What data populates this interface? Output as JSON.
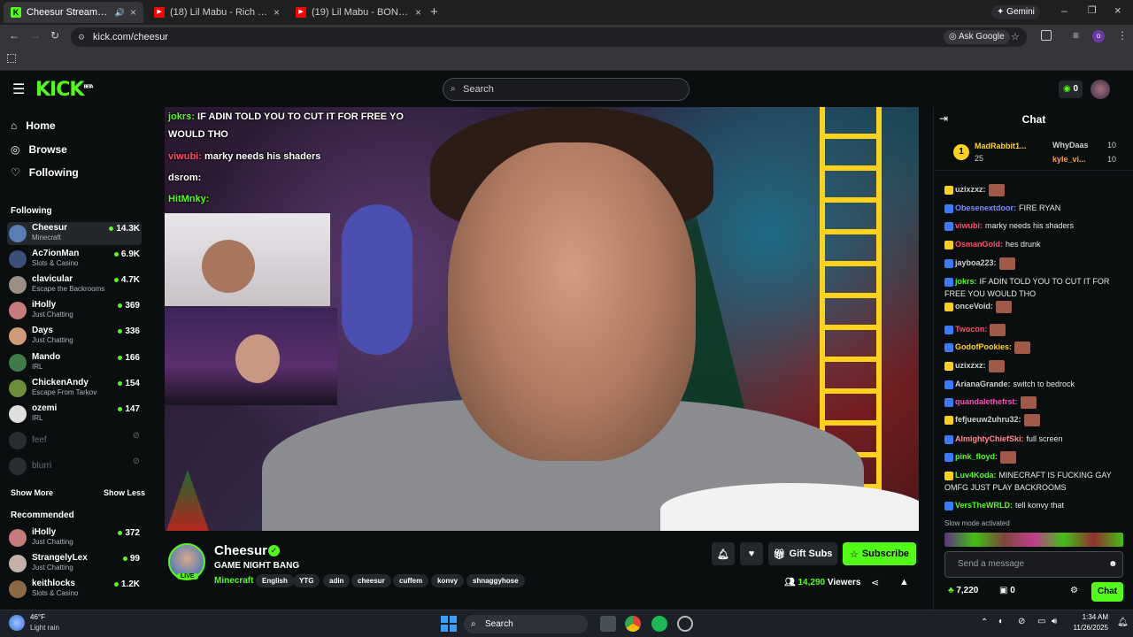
{
  "browser": {
    "tabs": [
      {
        "title": "Cheesur Stream - Watch Live",
        "favicon": "kick",
        "active": true
      },
      {
        "title": "(18) Lil Mabu - Rich Scholar (In…",
        "favicon": "youtube",
        "active": false
      },
      {
        "title": "(19) Lil Mabu - BONNIE BLU (Li…",
        "favicon": "youtube",
        "active": false
      }
    ],
    "gemini_label": "Gemini",
    "url": "kick.com/cheesur",
    "ask_google": "Ask Google"
  },
  "kick": {
    "logo": "KICK",
    "beta": "BETA",
    "search_placeholder": "Search",
    "kicks_count": "0"
  },
  "sidebar": {
    "nav": [
      {
        "label": "Home",
        "icon": "home-icon"
      },
      {
        "label": "Browse",
        "icon": "compass-icon"
      },
      {
        "label": "Following",
        "icon": "heart-icon"
      }
    ],
    "following_title": "Following",
    "following": [
      {
        "name": "Cheesur",
        "game": "Minecraft",
        "viewers": "14.3K",
        "color": "#5b7fb5"
      },
      {
        "name": "Ac7ionMan",
        "game": "Slots & Casino",
        "viewers": "6.9K",
        "color": "#3a4f7a"
      },
      {
        "name": "clavicular",
        "game": "Escape the Backrooms",
        "viewers": "4.7K",
        "color": "#9c8f86"
      },
      {
        "name": "iHolly",
        "game": "Just Chatting",
        "viewers": "369",
        "color": "#c67c7c"
      },
      {
        "name": "Days",
        "game": "Just Chatting",
        "viewers": "336",
        "color": "#d09a7a"
      },
      {
        "name": "Mando",
        "game": "IRL",
        "viewers": "166",
        "color": "#3f7a4a"
      },
      {
        "name": "ChickenAndy",
        "game": "Escape From Tarkov",
        "viewers": "154",
        "color": "#6e8f3a"
      },
      {
        "name": "ozemi",
        "game": "IRL",
        "viewers": "147",
        "color": "#dddddd"
      }
    ],
    "offline": [
      {
        "name": "feef"
      },
      {
        "name": "blurri"
      }
    ],
    "show_more": "Show More",
    "show_less": "Show Less",
    "recommended_title": "Recommended",
    "recommended": [
      {
        "name": "iHolly",
        "game": "Just Chatting",
        "viewers": "372",
        "color": "#c67c7c"
      },
      {
        "name": "StrangelyLex",
        "game": "Just Chatting",
        "viewers": "99",
        "color": "#c2b2a8"
      },
      {
        "name": "keithlocks",
        "game": "Slots & Casino",
        "viewers": "1.2K",
        "color": "#8a6a44"
      }
    ]
  },
  "video_overlay_chat": [
    {
      "user": "jokrs:",
      "text": "IF ADIN TOLD YOU TO CUT IT FOR FREE YO",
      "user_color": "#53fc18"
    },
    {
      "user": "",
      "text": "WOULD THO",
      "user_color": "#ffffff"
    },
    {
      "user": "viwubi:",
      "text": "marky needs his shaders",
      "user_color": "#ff4d6d"
    },
    {
      "user": "dsrom:",
      "text": "",
      "user_color": "#ffffff"
    },
    {
      "user": "HitMnky:",
      "text": "",
      "user_color": "#53fc18"
    }
  ],
  "stream": {
    "channel": "Cheesur",
    "live": "LIVE",
    "title": "GAME NIGHT BANG",
    "category": "Minecraft",
    "tags": [
      "English",
      "YTG",
      "adin",
      "cheesur",
      "cuffem",
      "konvy",
      "shnaggyhose"
    ],
    "gift_subs": "Gift Subs",
    "subscribe": "Subscribe",
    "viewers": "14,290",
    "viewers_label": "Viewers"
  },
  "chat": {
    "title": "Chat",
    "leaderboard": [
      {
        "rank": "1",
        "name": "MadRabbit1...",
        "count": "25"
      },
      {
        "name": "WhyDaas",
        "count": "10"
      },
      {
        "name": "kyle_vi...",
        "count": "10"
      }
    ],
    "messages": [
      {
        "user": "uzixzxz:",
        "text": "",
        "color": "#cfcfcf",
        "emote": true
      },
      {
        "user": "Obesenextdoor:",
        "text": "FIRE RYAN",
        "color": "#7b8cff",
        "emote": false
      },
      {
        "user": "viwubi:",
        "text": "marky needs his shaders",
        "color": "#ff4d6d",
        "emote": false
      },
      {
        "user": "OsmanGold:",
        "text": "hes drunk",
        "color": "#ff4d6d",
        "emote": false
      },
      {
        "user": "jayboa223:",
        "text": "",
        "color": "#cfcfcf",
        "emote": true
      },
      {
        "user": "jokrs:",
        "text": "IF ADIN TOLD YOU TO CUT IT FOR FREE YOU WOULD THO",
        "color": "#53fc18",
        "emote": false
      },
      {
        "user": "onceVoid:",
        "text": "",
        "color": "#cfcfcf",
        "emote": true
      },
      {
        "user": "Twocon:",
        "text": "",
        "color": "#ff4d6d",
        "emote": true
      },
      {
        "user": "GodofPookies:",
        "text": "",
        "color": "#ffd21a",
        "emote": true
      },
      {
        "user": "uzixzxz:",
        "text": "",
        "color": "#cfcfcf",
        "emote": true
      },
      {
        "user": "ArianaGrande:",
        "text": "switch to bedrock",
        "color": "#cfcfcf",
        "emote": false
      },
      {
        "user": "quandalethefrst:",
        "text": "",
        "color": "#ff4db8",
        "emote": true
      },
      {
        "user": "fefjueuw2uhru32:",
        "text": "",
        "color": "#cfcfcf",
        "emote": true
      },
      {
        "user": "AlmightyChiefSki:",
        "text": "full screen",
        "color": "#ff8c8c",
        "emote": false
      },
      {
        "user": "pink_floyd:",
        "text": "",
        "color": "#53fc18",
        "emote": true
      },
      {
        "user": "Luv4Koda:",
        "text": "MINECRAFT IS FUCKING GAY OMFG JUST PLAY BACKROOMS",
        "color": "#53fc18",
        "emote": false
      },
      {
        "user": "VersTheWRLD:",
        "text": "tell konvy that",
        "color": "#53fc18",
        "emote": false
      }
    ],
    "slow_mode": "Slow mode activated",
    "input_placeholder": "Send a message",
    "points": "7,220",
    "chest_count": "0",
    "send_label": "Chat"
  },
  "taskbar": {
    "weather_temp": "46°F",
    "weather_desc": "Light rain",
    "search": "Search",
    "time": "1:34 AM",
    "date": "11/26/2025"
  }
}
